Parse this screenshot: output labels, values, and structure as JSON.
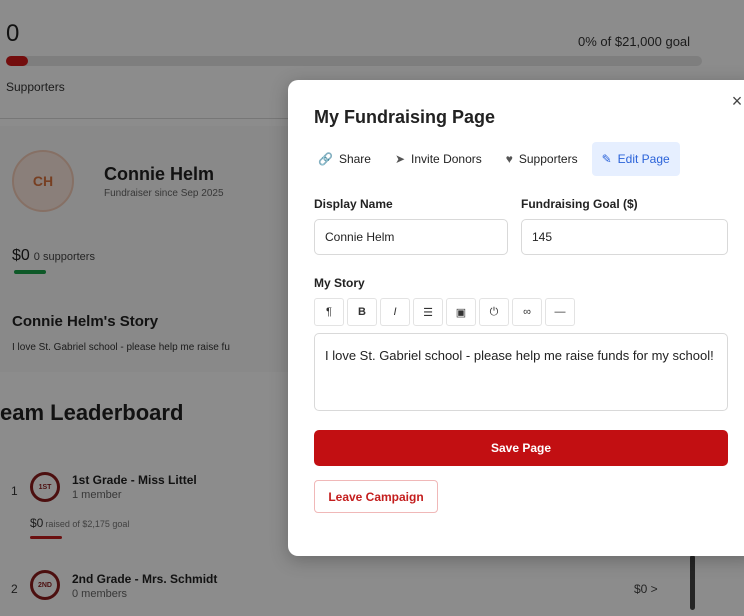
{
  "campaign": {
    "raised": "0",
    "goal_text": "0% of $21,000 goal",
    "progress_fraction": 0.0,
    "supporters_label": "Supporters"
  },
  "profile": {
    "initials": "CH",
    "name": "Connie Helm",
    "since": "Fundraiser since Sep 2025",
    "amount": "$0",
    "supporters": "0 supporters",
    "story_title": "Connie Helm's Story",
    "story_text": "I love St. Gabriel school - please help me raise fu"
  },
  "leaderboard": {
    "title": "eam Leaderboard",
    "rows": [
      {
        "rank": "1",
        "badge": "1ST",
        "name": "1st Grade - Miss Littel",
        "members": "1 member",
        "raised": "$0",
        "raised_suffix": "raised of $2,175 goal"
      },
      {
        "rank": "2",
        "badge": "2ND",
        "name": "2nd Grade - Mrs. Schmidt",
        "members": "0 members",
        "right": "$0 >"
      }
    ]
  },
  "modal": {
    "title": "My Fundraising Page",
    "close_icon": "×",
    "tabs": [
      {
        "icon": "link-icon",
        "glyph": "🔗",
        "label": "Share"
      },
      {
        "icon": "send-icon",
        "glyph": "➤",
        "label": "Invite Donors"
      },
      {
        "icon": "heart-icon",
        "glyph": "♥",
        "label": "Supporters"
      },
      {
        "icon": "pencil-icon",
        "glyph": "✎",
        "label": "Edit Page",
        "active": true
      }
    ],
    "display_name_label": "Display Name",
    "display_name_value": "Connie Helm",
    "goal_label": "Fundraising Goal ($)",
    "goal_value": "145",
    "story_label": "My Story",
    "toolbar": [
      {
        "icon": "paragraph-icon",
        "glyph": "¶"
      },
      {
        "icon": "bold-icon",
        "glyph": "B"
      },
      {
        "icon": "italic-icon",
        "glyph": "I"
      },
      {
        "icon": "list-icon",
        "glyph": "☰"
      },
      {
        "icon": "image-icon",
        "glyph": "▣"
      },
      {
        "icon": "video-icon",
        "glyph": "⏻"
      },
      {
        "icon": "link-icon",
        "glyph": "∞"
      },
      {
        "icon": "horizontal-rule-icon",
        "glyph": "—"
      }
    ],
    "story_value": "I love St. Gabriel school - please help me raise funds for my school!",
    "save_label": "Save Page",
    "leave_label": "Leave Campaign"
  },
  "colors": {
    "primary_red": "#c20f12",
    "active_tab_bg": "#e6efff",
    "active_tab_text": "#2b63d9",
    "success_green": "#1aa34a"
  }
}
